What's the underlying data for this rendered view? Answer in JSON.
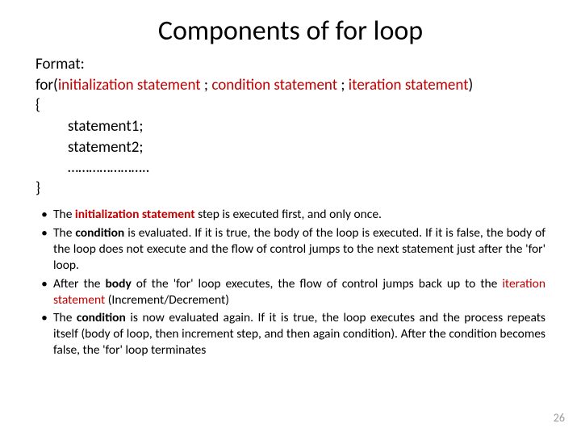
{
  "title": "Components of for loop",
  "format": {
    "label": "Format:",
    "line_for_prefix": "for(",
    "init": "initialization statement",
    "sep": " ; ",
    "cond": "condition statement",
    "iter": "iteration statement",
    "line_for_suffix": ")",
    "brace_open": "{",
    "stmt1": "statement1;",
    "stmt2": "statement2;",
    "dots": "…………………..",
    "brace_close": "}"
  },
  "bullets": {
    "0": {
      "pre": "The ",
      "red": "initialization statement",
      "post": " step is executed first, and only once."
    },
    "1": {
      "pre": "The ",
      "bold": "condition",
      "post": " is evaluated. If it is true, the body of the loop is executed. If it is false, the body of the loop does not execute and the flow of control jumps to the next statement just after the 'for' loop."
    },
    "2": {
      "pre": "After the ",
      "bold": "body",
      "mid": " of the 'for' loop executes, the flow of control jumps back up to the ",
      "red": "iteration statement",
      "post": " (Increment/Decrement)"
    },
    "3": {
      "pre": "The ",
      "bold": "condition",
      "post": " is now evaluated again. If it is true, the loop executes and the process repeats itself (body of loop, then increment step, and then again condition). After the condition becomes false, the 'for' loop terminates"
    }
  },
  "marker": "•",
  "pagenum": "26"
}
